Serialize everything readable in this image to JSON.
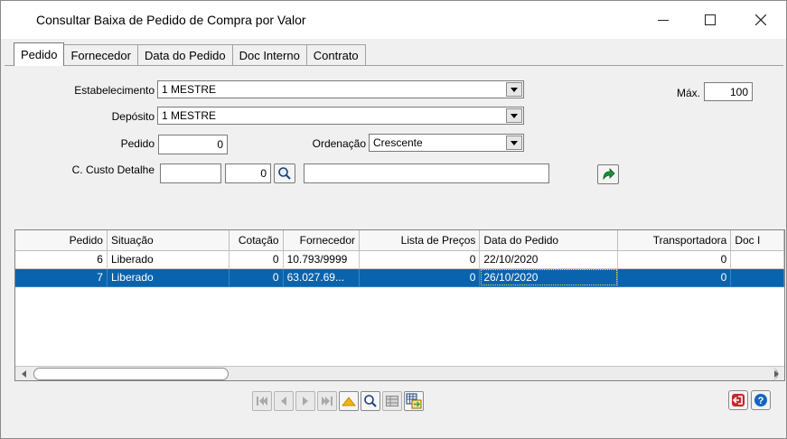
{
  "window": {
    "title": "Consultar Baixa de Pedido de Compra por Valor"
  },
  "tabs": [
    {
      "label": "Pedido",
      "active": true
    },
    {
      "label": "Fornecedor",
      "active": false
    },
    {
      "label": "Data do Pedido",
      "active": false
    },
    {
      "label": "Doc Interno",
      "active": false
    },
    {
      "label": "Contrato",
      "active": false
    }
  ],
  "form": {
    "estabelecimento_label": "Estabelecimento",
    "estabelecimento_value": "1 MESTRE",
    "deposito_label": "Depósito",
    "deposito_value": "1 MESTRE",
    "pedido_label": "Pedido",
    "pedido_value": "0",
    "ordenacao_label": "Ordenação",
    "ordenacao_value": "Crescente",
    "custo_label": "C. Custo Detalhe",
    "custo_value1": "",
    "custo_value2": "0",
    "custo_desc": "",
    "max_label": "Máx.",
    "max_value": "100"
  },
  "grid": {
    "columns": [
      "Pedido",
      "Situação",
      "Cotação",
      "Fornecedor",
      "Lista de Preços",
      "Data do Pedido",
      "Transportadora",
      "Doc I"
    ],
    "rows": [
      {
        "pedido": "6",
        "situacao": "Liberado",
        "cotacao": "0",
        "fornecedor": "10.793/9999",
        "lista": "0",
        "data": "22/10/2020",
        "transp": "0",
        "doc": "",
        "selected": false
      },
      {
        "pedido": "7",
        "situacao": "Liberado",
        "cotacao": "0",
        "fornecedor": "63.027.69...",
        "lista": "0",
        "data": "26/10/2020",
        "transp": "0",
        "doc": "",
        "selected": true
      }
    ]
  },
  "navbar": {
    "icons": [
      "first-record-icon",
      "prior-record-icon",
      "next-record-icon",
      "last-record-icon",
      "sort-up-icon",
      "search-icon",
      "grid-view-icon",
      "export-icon"
    ]
  },
  "colors": {
    "selection": "#0a64ad",
    "go_arrow": "#1e8f3a",
    "exit": "#c62828",
    "help": "#1565c0"
  }
}
